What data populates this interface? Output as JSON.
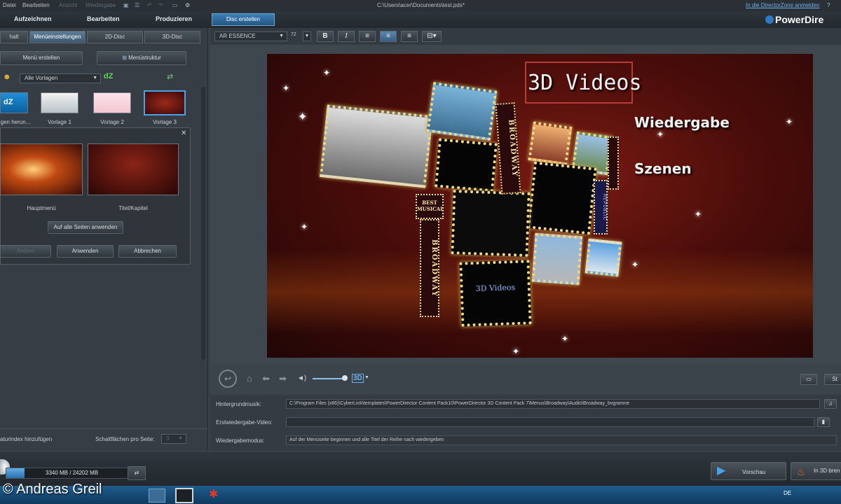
{
  "menubar": {
    "items": [
      "Datei",
      "Bearbeiten",
      "Ansicht",
      "Wiedergabe"
    ],
    "title": "C:\\Users\\acer\\Documents\\test.pds*",
    "director_zone": "In die DirectorZone anmelden",
    "help": "?"
  },
  "modes": {
    "capture": "Aufzeichnen",
    "edit": "Bearbeiten",
    "produce": "Produzieren",
    "disc": "Disc erstellen"
  },
  "logo": "PowerDire",
  "left_tabs": [
    "halt",
    "Menüeinstellungen",
    "2D-Disc",
    "3D-Disc"
  ],
  "create_menu": "Menü erstellen",
  "menu_structure": "Menüstruktur",
  "templates_dropdown": "Alle Vorlagen",
  "templates": [
    "gen herun...",
    "Vorlage 1",
    "Vorlage 2",
    "Vorlage 3"
  ],
  "popup": {
    "items": [
      "Hauptmenü",
      "Titel/Kapitel"
    ],
    "apply_all": "Auf alle Seiten anwenden",
    "change": "Ändern",
    "apply": "Anwenden",
    "cancel": "Abbrechen",
    "close": "✕"
  },
  "left_bottom": {
    "chapter_index": "aturindex hinzufügen",
    "buttons_per_page": "Schaltflächen pro Seite:",
    "buttons_count": "3"
  },
  "format": {
    "font": "AR ESSENCE",
    "size": "72",
    "bold": "B",
    "italic": "I"
  },
  "preview": {
    "title": "3D Videos",
    "play": "Wiedergabe",
    "scenes": "Szenen",
    "badge1": "BROADWAY",
    "badge2": "BEST MUSICAL",
    "badge3": "BROADWAY",
    "badge4": "REPUBLIC",
    "thumb_text": "3D Videos"
  },
  "transport": {
    "mode": "3D",
    "stop": "St"
  },
  "properties": {
    "bg_music_label": "Hintergrundmusik:",
    "bg_music_value": "C:\\Program Files (x86)\\CyberLink\\templates\\PowerDirector Content Pack10\\PowerDirector 3D Content Pack 7\\Menus\\Broadway\\Audio\\Broadway_bvgramne",
    "first_video_label": "Erstwiedergabe-Video:",
    "first_video_value": "",
    "playmode_label": "Wiedergabemodus:",
    "playmode_value": "Auf der Menüseite beginnen und alle Titel der Reihe nach wiedergeben"
  },
  "bottom": {
    "disc_usage": "3340 MB / 24202 MB",
    "disc_fraction": 0.138,
    "preview": "Vorschau",
    "burn": "In 3D bren"
  },
  "copyright": "© Andreas Greil",
  "taskbar": {
    "lang": "DE"
  }
}
